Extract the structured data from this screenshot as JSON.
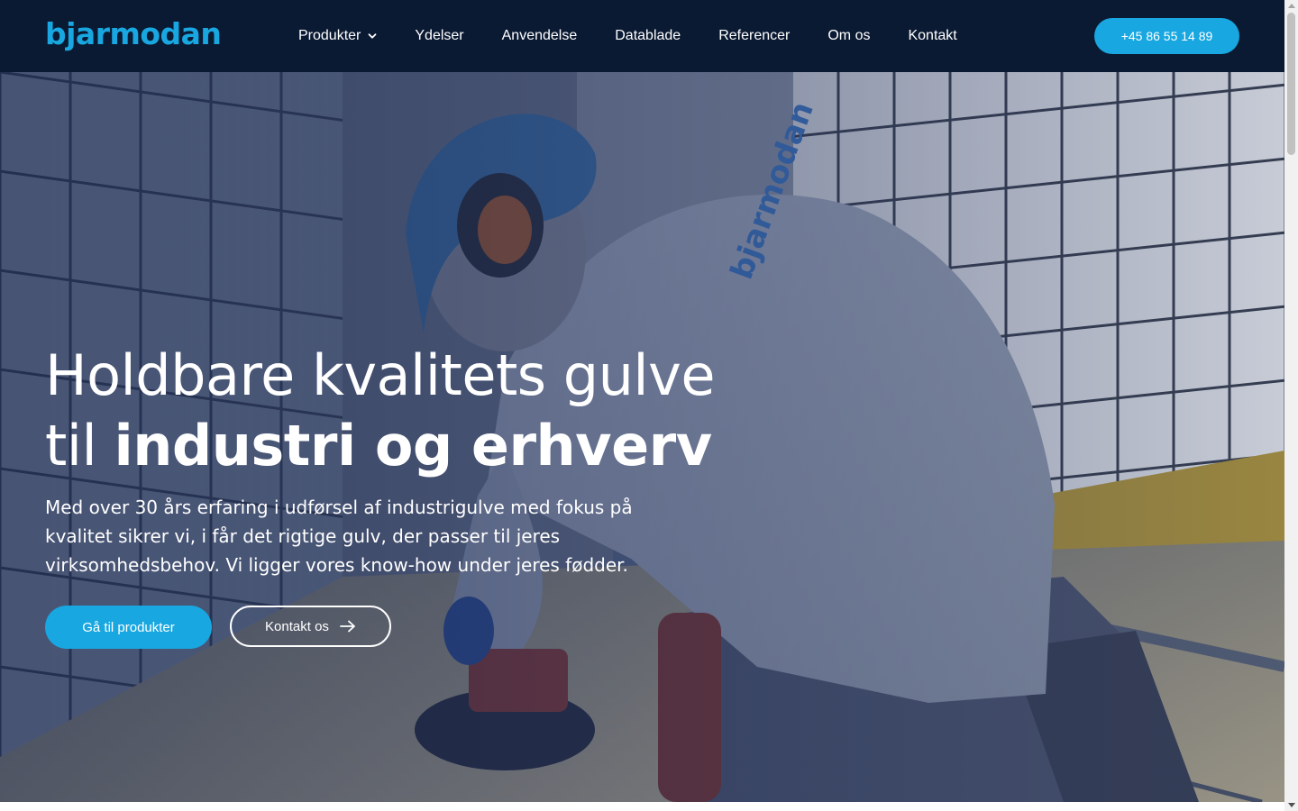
{
  "brand": {
    "logo_text": "bjarmodan",
    "accent_color": "#18a7e0",
    "nav_bg": "#0b1a33"
  },
  "nav": {
    "items": [
      {
        "label": "Produkter",
        "has_dropdown": true,
        "icon": "chevron-down-icon"
      },
      {
        "label": "Ydelser"
      },
      {
        "label": "Anvendelse"
      },
      {
        "label": "Datablade"
      },
      {
        "label": "Referencer"
      },
      {
        "label": "Om os"
      },
      {
        "label": "Kontakt"
      }
    ],
    "phone_button": "+45 86 55 14 89"
  },
  "hero": {
    "title_line1": "Holdbare kvalitets gulve",
    "title_line2_prefix": "til ",
    "title_line2_bold": "industri og erhverv",
    "text": "Med over 30 års erfaring i udførsel af industrigulve med fokus på kvalitet sikrer vi, i får det rigtige gulv, der passer til jeres virksomhedsbehov.  Vi ligger vores know-how under jeres fødder.",
    "primary_button": "Gå til produkter",
    "secondary_button": "Kontakt os",
    "secondary_icon": "arrow-right-icon",
    "background_image": "worker sanding industrial floor",
    "shirt_print": "bjarmodan"
  }
}
